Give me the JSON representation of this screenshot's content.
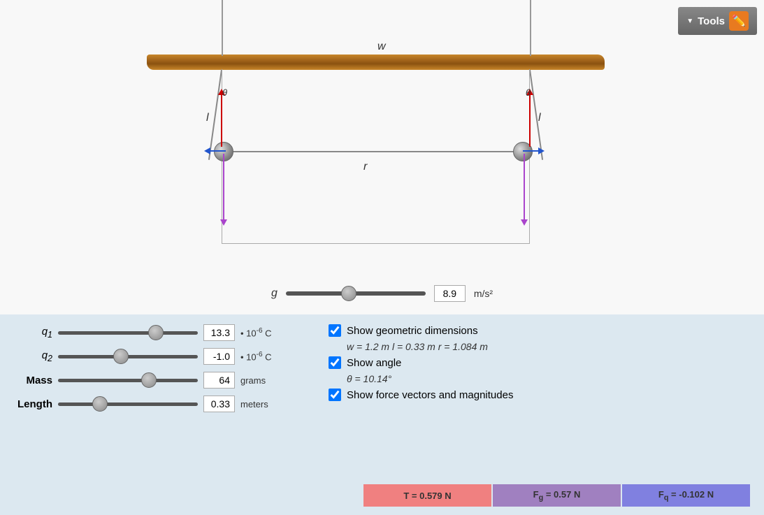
{
  "tools": {
    "label": "Tools"
  },
  "simulation": {
    "beam_label": "w",
    "r_label": "r",
    "l_left_label": "l",
    "l_right_label": "l",
    "theta_label": "θ",
    "g_label": "g",
    "g_value": "8.9",
    "g_unit": "m/s²"
  },
  "controls": {
    "q1_label": "q₁",
    "q1_value": "13.3",
    "q1_exponent": "-6",
    "q1_unit": "C",
    "q2_label": "q₂",
    "q2_value": "-1.0",
    "q2_exponent": "-6",
    "q2_unit": "C",
    "mass_label": "Mass",
    "mass_value": "64",
    "mass_unit": "grams",
    "length_label": "Length",
    "length_value": "0.33",
    "length_unit": "meters"
  },
  "checkboxes": {
    "show_geometric": {
      "label": "Show geometric dimensions",
      "checked": true
    },
    "dimensions_values": "w = 1.2 m   l = 0.33 m   r = 1.084 m",
    "show_angle": {
      "label": "Show angle",
      "checked": true
    },
    "angle_value": "θ = 10.14°",
    "show_force": {
      "label": "Show force vectors and magnitudes",
      "checked": true
    }
  },
  "force_bars": {
    "T": "T = 0.579 N",
    "Fg": "Fg = 0.57 N",
    "Fq": "Fq = -0.102 N"
  },
  "slider_positions": {
    "g": 45,
    "q1": 70,
    "q2": 45,
    "mass": 65,
    "length": 30
  }
}
